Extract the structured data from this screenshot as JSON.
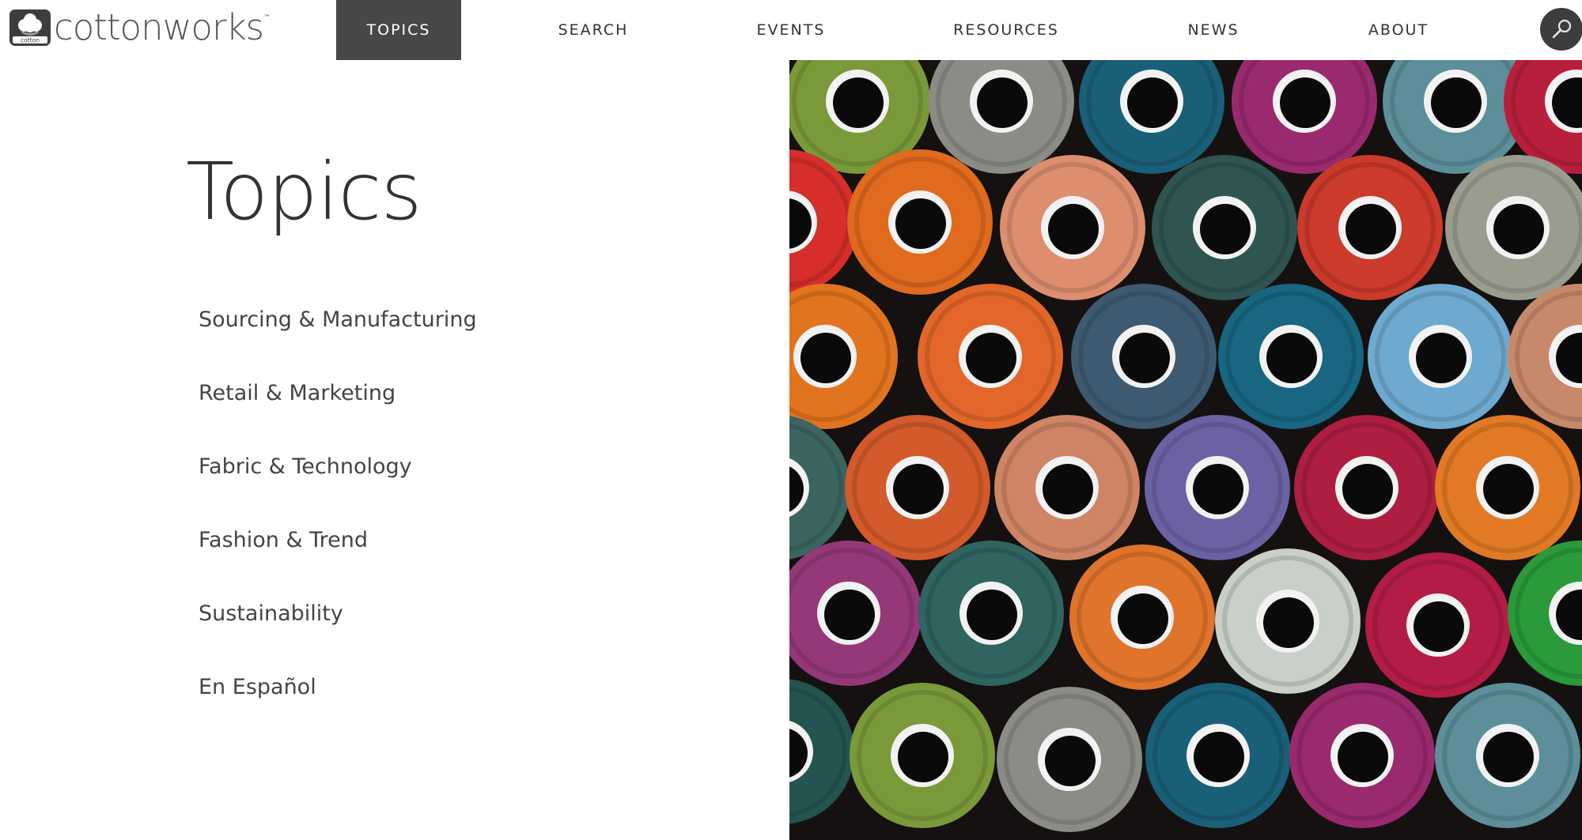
{
  "brand": {
    "name": "cottonworks",
    "trademark": "™",
    "mark_caption": "cotton"
  },
  "nav": {
    "items": [
      {
        "label": "TOPICS",
        "active": true
      },
      {
        "label": "SEARCH",
        "active": false
      },
      {
        "label": "EVENTS",
        "active": false
      },
      {
        "label": "RESOURCES",
        "active": false
      },
      {
        "label": "NEWS",
        "active": false
      },
      {
        "label": "ABOUT",
        "active": false
      }
    ]
  },
  "page": {
    "title": "Topics"
  },
  "topics": [
    "Sourcing & Manufacturing",
    "Retail & Marketing",
    "Fabric & Technology",
    "Fashion & Trend",
    "Sustainability",
    "En Español"
  ],
  "hero": {
    "image": "colorful-thread-spools-photo",
    "spool_colors": [
      "#7a9a3a",
      "#8c8c86",
      "#1a5f78",
      "#9a2a6e",
      "#5c8f9a",
      "#b81f3c",
      "#d62e2a",
      "#e06a1e",
      "#dc8e6f",
      "#2f5452",
      "#cc3a2b",
      "#9a9d8e",
      "#e2741f",
      "#e3672a",
      "#3e5a70",
      "#186681",
      "#6ea9cf",
      "#c8896a",
      "#3c6561",
      "#d35a2a",
      "#cf8465",
      "#6a62a3",
      "#ad1e40",
      "#e27a25",
      "#953878",
      "#2f6461",
      "#e0742a",
      "#c9cfc9",
      "#b31c44",
      "#2a9a3a",
      "#245452"
    ]
  },
  "icons": {
    "search": "search-icon",
    "logo": "cotton-boll-icon"
  },
  "colors": {
    "nav_active_bg": "#474747",
    "text": "#333333",
    "logo_mark_bg": "#3d3d3d"
  }
}
